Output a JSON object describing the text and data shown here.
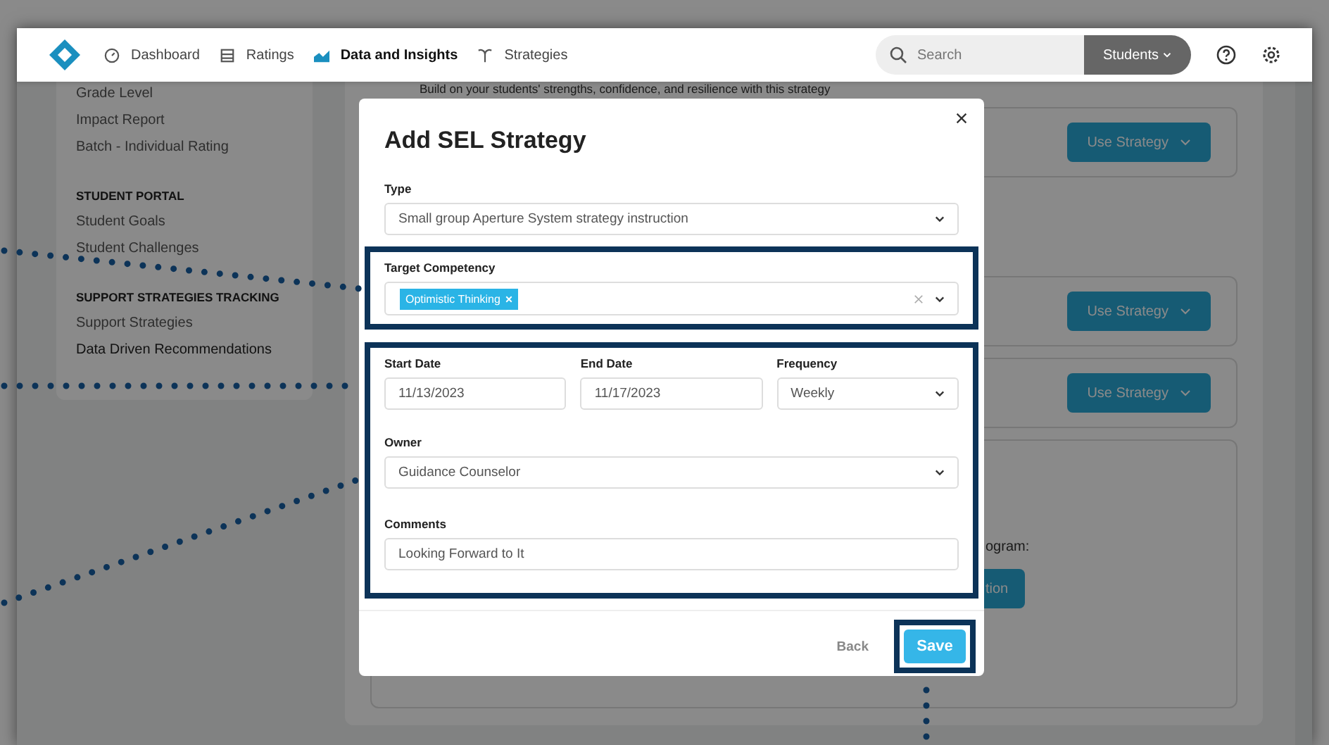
{
  "navbar": {
    "items": [
      {
        "label": "Dashboard",
        "selected": false
      },
      {
        "label": "Ratings",
        "selected": false
      },
      {
        "label": "Data and Insights",
        "selected": true
      },
      {
        "label": "Strategies",
        "selected": false
      }
    ],
    "search": {
      "placeholder": "Search"
    },
    "role_button": "Students"
  },
  "sidebar": {
    "groups": [
      {
        "items": [
          {
            "label": "Grade Level",
            "selected": false
          },
          {
            "label": "Impact Report",
            "selected": false
          },
          {
            "label": "Batch - Individual Rating",
            "selected": false
          }
        ]
      },
      {
        "heading": "STUDENT PORTAL",
        "items": [
          {
            "label": "Student Goals",
            "selected": false
          },
          {
            "label": "Student Challenges",
            "selected": false
          }
        ]
      },
      {
        "heading": "SUPPORT STRATEGIES TRACKING",
        "items": [
          {
            "label": "Support Strategies",
            "selected": false
          },
          {
            "label": "Data Driven Recommendations",
            "selected": true
          }
        ]
      }
    ]
  },
  "main": {
    "intro": "Build on your students' strengths, confidence, and resilience with this strategy",
    "cards": [
      {
        "kind": "strategy",
        "button": "Use Strategy"
      },
      {
        "kind": "spacer"
      },
      {
        "kind": "strategy",
        "button": "Use Strategy"
      },
      {
        "kind": "strategy",
        "button": "Use Strategy"
      },
      {
        "kind": "program",
        "text": "ogram:",
        "button": "tion"
      }
    ]
  },
  "modal": {
    "title": "Add SEL Strategy",
    "type": {
      "label": "Type",
      "value": "Small group Aperture System strategy instruction"
    },
    "target_competency": {
      "label": "Target Competency",
      "tags": [
        "Optimistic Thinking"
      ]
    },
    "start_date": {
      "label": "Start Date",
      "value": "11/13/2023"
    },
    "end_date": {
      "label": "End Date",
      "value": "11/17/2023"
    },
    "frequency": {
      "label": "Frequency",
      "value": "Weekly"
    },
    "owner": {
      "label": "Owner",
      "value": "Guidance Counselor"
    },
    "comments": {
      "label": "Comments",
      "value": "Looking Forward to It"
    },
    "back_button": "Back",
    "save_button": "Save"
  }
}
